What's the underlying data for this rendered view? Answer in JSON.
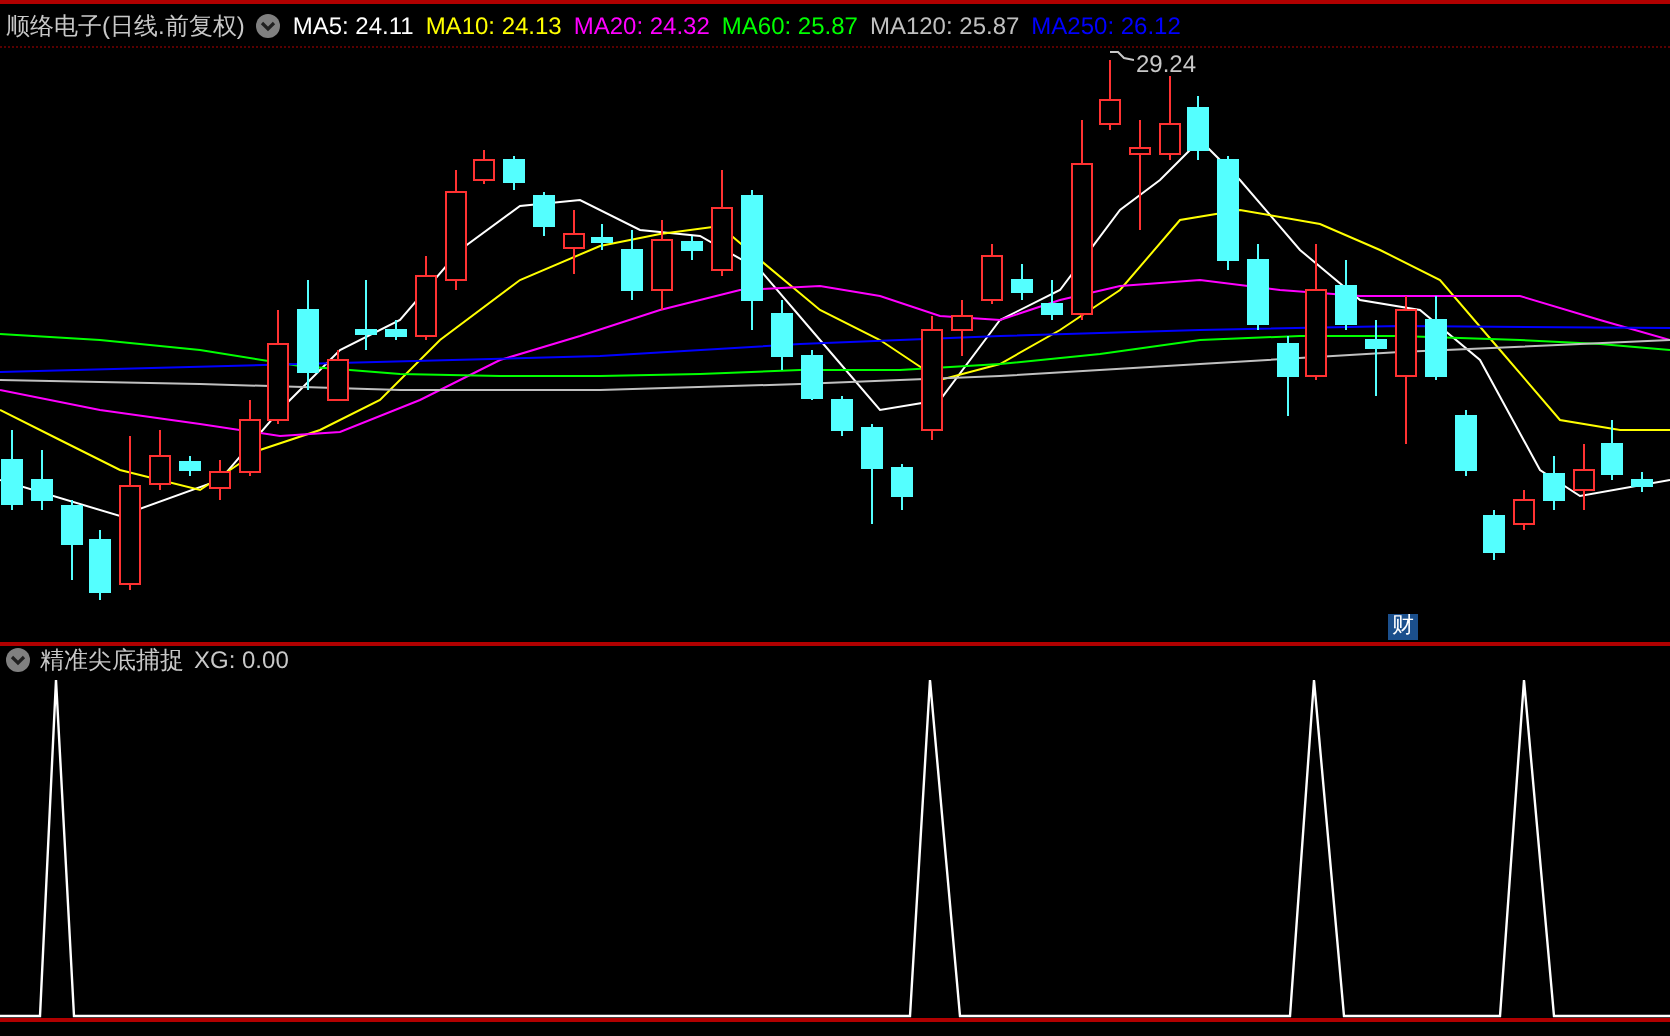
{
  "chart_header": {
    "title": "顺络电子(日线.前复权)",
    "moving_averages": [
      {
        "text": "MA5: 24.11",
        "color": "#ffffff"
      },
      {
        "text": "MA10: 24.13",
        "color": "#ffff00"
      },
      {
        "text": "MA20: 24.32",
        "color": "#ff00ff"
      },
      {
        "text": "MA60: 25.87",
        "color": "#00ff00"
      },
      {
        "text": "MA120: 25.87",
        "color": "#c0c0c0"
      },
      {
        "text": "MA250: 26.12",
        "color": "#0000ff"
      }
    ]
  },
  "price_chart": {
    "high_label": "29.24",
    "event_badge": "财"
  },
  "indicator_panel": {
    "name": "精准尖底捕捉",
    "reading": "XG: 0.00"
  }
}
